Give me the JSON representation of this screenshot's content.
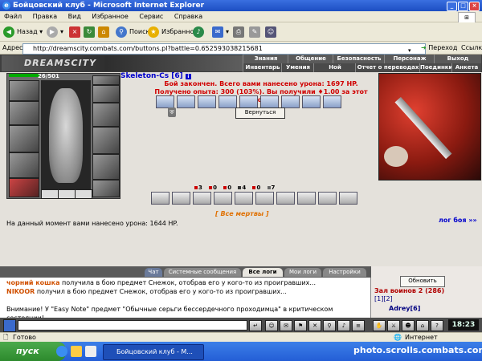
{
  "window": {
    "title": "Бойцовский клуб - Microsoft Internet Explorer"
  },
  "menu": [
    "Файл",
    "Правка",
    "Вид",
    "Избранное",
    "Сервис",
    "Справка"
  ],
  "toolbar": {
    "back": "Назад",
    "search": "Поиск",
    "favorites": "Избранное"
  },
  "address": {
    "label": "Адрес:",
    "url": "http://dreamscity.combats.com/buttons.pl?battle=0.652593038215681",
    "go": "Переход",
    "links": "Ссылки"
  },
  "game_header": {
    "logo": "DREAMSCITY",
    "nav_top": [
      "Знания",
      "Общение",
      "Безопасность",
      "Персонаж",
      "Выход"
    ],
    "nav_bottom": [
      "Инвентарь",
      "Умения",
      "Ной Скроллл",
      "Отчет о переводах",
      "Поединки",
      "Анкета"
    ]
  },
  "character": {
    "hp": "26/501",
    "name": "Skeleton-Cs [6]"
  },
  "battle": {
    "result_text": "Бой закончен. Всего вами нанесено урона: 1697 HP. Получено опыта: 300 (103%). Вы получили ♦1.00 за этот бой.",
    "back_button": "Вернуться",
    "all_dead": "[ Все мертвы ]",
    "log_link": "лог боя »»",
    "damage_now": "На данный момент вами нанесено урона: 1644 HP.",
    "stats": [
      "3",
      "0",
      "0",
      "4",
      "0",
      "7"
    ]
  },
  "chat": {
    "tabs": [
      "Чат",
      "Системные сообщения",
      "Все логи",
      "Мои логи",
      "Настройки"
    ],
    "active_tab": 2,
    "lines": [
      {
        "nick": "чорний кошка",
        "text": " получила в бою предмет Снежок, отобрав его у кого-то из проигравших..."
      },
      {
        "nick": "NIKOOR",
        "text": " получил в бою предмет Снежок, отобрав его у кого-то из проигравших..."
      },
      {
        "nick": "",
        "text": ""
      },
      {
        "nick": "",
        "text": "Внимание! У \"Easy Note\" предмет \"Обычные серьги бессердечного проходимца\" в критическом состоянии!"
      }
    ]
  },
  "roster": {
    "refresh": "Обновить",
    "hall": "Зал воинов 2 (286)",
    "pages": "[1][2]",
    "user": "Adrey[6]"
  },
  "clock": "18:23",
  "statusbar": {
    "left": "Готово",
    "right": "Интернет"
  },
  "taskbar": {
    "start": "пуск",
    "item": "Бойцовский клуб - M...",
    "watermark": "photo.scrolls.combats.com"
  },
  "colors": {
    "result_red": "#d00000",
    "link_blue": "#0000cc",
    "nick_orange": "#d05000"
  }
}
